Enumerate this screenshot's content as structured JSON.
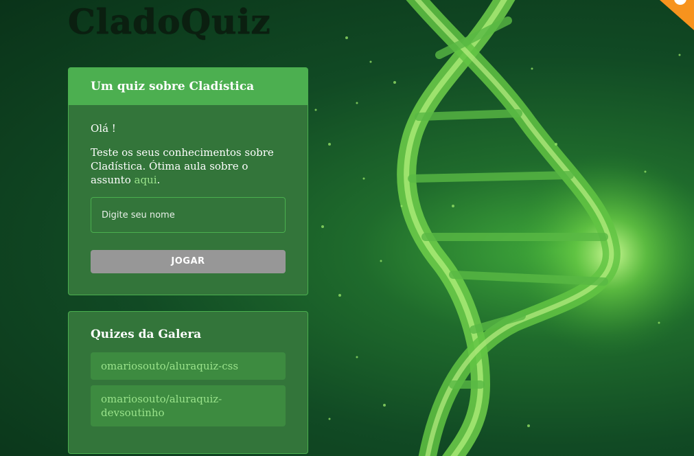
{
  "logo": {
    "text": "CladoQuiz"
  },
  "main_widget": {
    "title": "Um quiz sobre Cladística",
    "greeting": "Olá !",
    "description": "Teste os seus conhecimentos sobre Cladística. Ótima aula sobre o assunto",
    "link_text": "aqui",
    "link_suffix": ".",
    "name_input": {
      "placeholder": "Digite seu nome",
      "value": ""
    },
    "play_button": "JOGAR"
  },
  "community_widget": {
    "title": "Quizes da Galera",
    "items": [
      {
        "label": "omariosouto/aluraquiz-css"
      },
      {
        "label": "omariosouto/aluraquiz-devsoutinho"
      }
    ]
  },
  "colors": {
    "background": "#114a24",
    "widget_bg": "#33753a",
    "header_bg": "#4caf50",
    "border": "#4bb04f",
    "link": "#9ae38b",
    "button_disabled": "#979797",
    "corner_ribbon": "#f7931e"
  }
}
